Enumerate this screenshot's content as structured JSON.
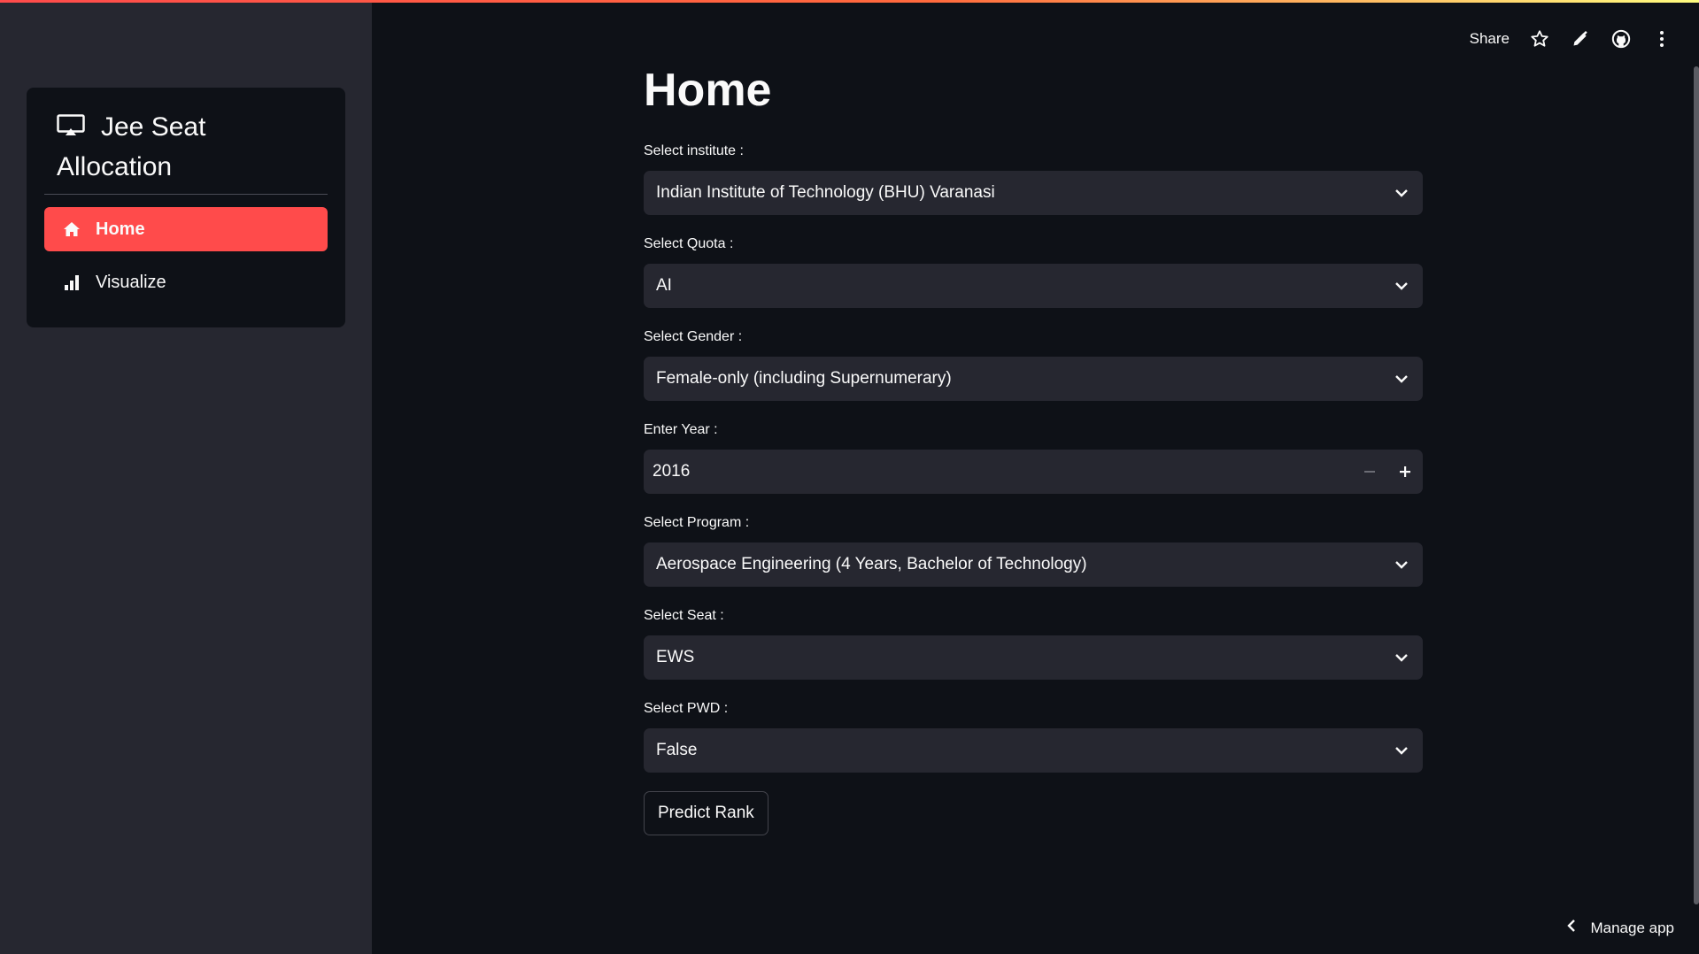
{
  "app": {
    "title_line1": "Jee Seat",
    "title_line2": "Allocation"
  },
  "sidebar": {
    "items": [
      {
        "label": "Home",
        "icon": "house-icon",
        "active": true
      },
      {
        "label": "Visualize",
        "icon": "bar-chart-icon",
        "active": false
      }
    ]
  },
  "toolbar": {
    "share_label": "Share",
    "icons": [
      "star-icon",
      "pencil-icon",
      "github-icon",
      "more-vertical-icon"
    ]
  },
  "main": {
    "page_title": "Home",
    "fields": {
      "institute": {
        "label": "Select institute :",
        "value": "Indian Institute of Technology (BHU) Varanasi"
      },
      "quota": {
        "label": "Select Quota :",
        "value": "AI"
      },
      "gender": {
        "label": "Select Gender :",
        "value": "Female-only (including Supernumerary)"
      },
      "year": {
        "label": "Enter Year :",
        "value": "2016"
      },
      "program": {
        "label": "Select Program :",
        "value": "Aerospace Engineering (4 Years, Bachelor of Technology)"
      },
      "seat": {
        "label": "Select Seat :",
        "value": "EWS"
      },
      "pwd": {
        "label": "Select PWD :",
        "value": "False"
      }
    },
    "predict_label": "Predict Rank"
  },
  "footer": {
    "manage_label": "Manage app"
  },
  "colors": {
    "background": "#0e1117",
    "sidebar": "#262730",
    "accent": "#ff4b4b",
    "input_bg": "#262730"
  }
}
